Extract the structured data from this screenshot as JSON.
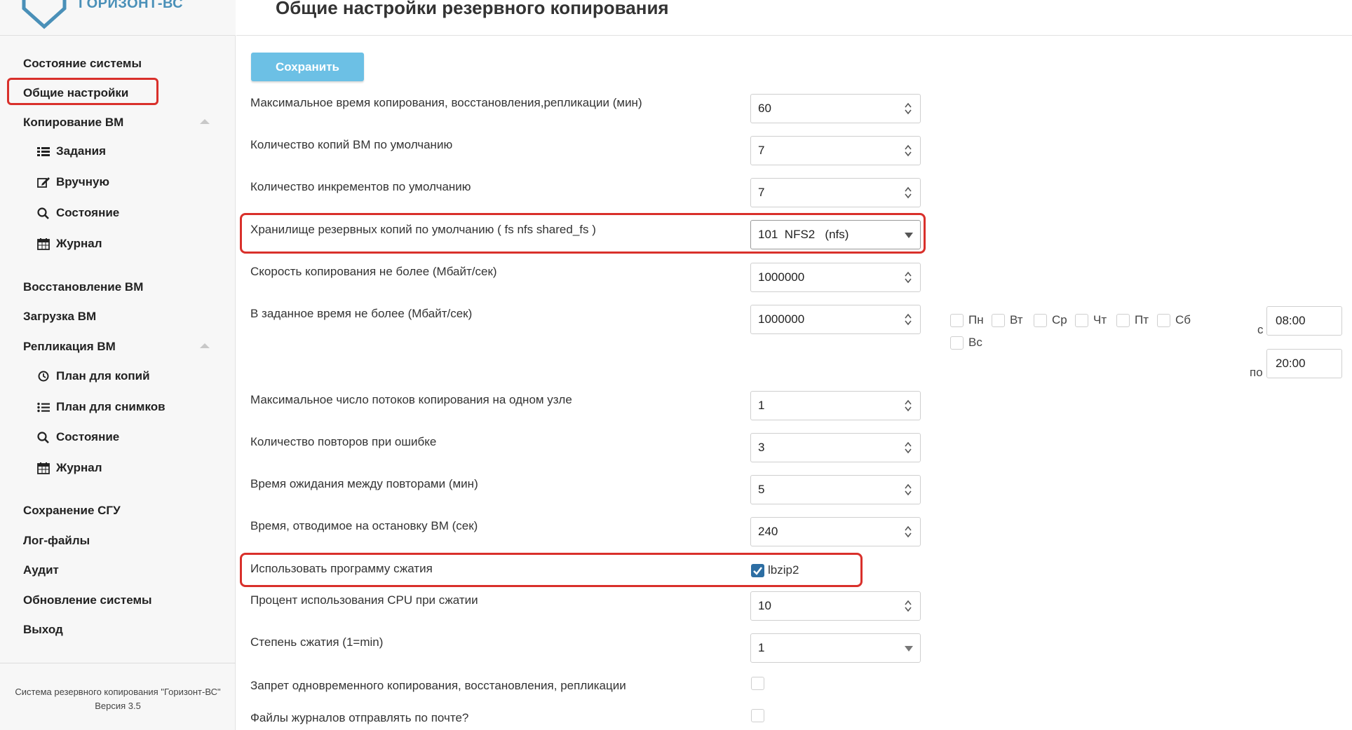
{
  "brand": "ГОРИЗОНТ-ВС",
  "page_title": "Общие настройки резервного копирования",
  "save_label": "Сохранить",
  "nav": {
    "system_state": "Состояние системы",
    "general_settings": "Общие настройки",
    "vm_copy": "Копирование ВМ",
    "tasks": "Задания",
    "manual": "Вручную",
    "copy_state": "Состояние",
    "copy_journal": "Журнал",
    "vm_restore": "Восстановление ВМ",
    "vm_load": "Загрузка ВМ",
    "vm_replication": "Репликация ВМ",
    "plan_copies": "План для копий",
    "plan_snapshots": "План для снимков",
    "repl_state": "Состояние",
    "repl_journal": "Журнал",
    "save_sgu": "Сохранение СГУ",
    "logs": "Лог-файлы",
    "audit": "Аудит",
    "update": "Обновление системы",
    "exit": "Выход"
  },
  "footer": {
    "line1": "Система резервного копирования \"Горизонт-ВС\"",
    "line2": "Версия 3.5"
  },
  "settings": {
    "max_time": {
      "label": "Максимальное время копирования, восстановления,репликации (мин)",
      "value": "60"
    },
    "copies_default": {
      "label": "Количество копий ВМ по умолчанию",
      "value": "7"
    },
    "increments_default": {
      "label": "Количество инкрементов по умолчанию",
      "value": "7"
    },
    "storage_default": {
      "label": "Хранилище резервных копий по умолчанию ( fs nfs shared_fs )",
      "value": "101  NFS2   (nfs)"
    },
    "speed_limit": {
      "label": "Скорость копирования не более (Мбайт/сек)",
      "value": "1000000"
    },
    "scheduled_speed": {
      "label": "В заданное время не более (Мбайт/сек)",
      "value": "1000000"
    },
    "max_threads": {
      "label": "Максимальное число потоков копирования на одном узле",
      "value": "1"
    },
    "retries": {
      "label": "Количество повторов при ошибке",
      "value": "3"
    },
    "retry_wait": {
      "label": "Время ожидания между повторами (мин)",
      "value": "5"
    },
    "vm_stop_time": {
      "label": "Время, отводимое на остановку ВМ (сек)",
      "value": "240"
    },
    "compression": {
      "label": "Использовать программу сжатия",
      "value": "lbzip2",
      "checked": true
    },
    "cpu_percent": {
      "label": "Процент использования CPU при сжатии",
      "value": "10"
    },
    "compression_level": {
      "label": "Степень сжатия (1=min)",
      "value": "1"
    },
    "concurrency_ban": {
      "label": "Запрет одновременного копирования, восстановления, репликации",
      "checked": false
    },
    "mail_logs": {
      "label": "Файлы журналов отправлять по почте?",
      "checked": false
    }
  },
  "schedule": {
    "days": [
      "Пн",
      "Вт",
      "Ср",
      "Чт",
      "Пт",
      "Сб",
      "Вс"
    ],
    "from_prefix": "с",
    "to_prefix": "по",
    "from_time": "08:00",
    "to_time": "20:00"
  },
  "colors": {
    "accent": "#6cc0e5",
    "highlight": "#d9302b",
    "checkbox_checked": "#2d6ea3"
  }
}
